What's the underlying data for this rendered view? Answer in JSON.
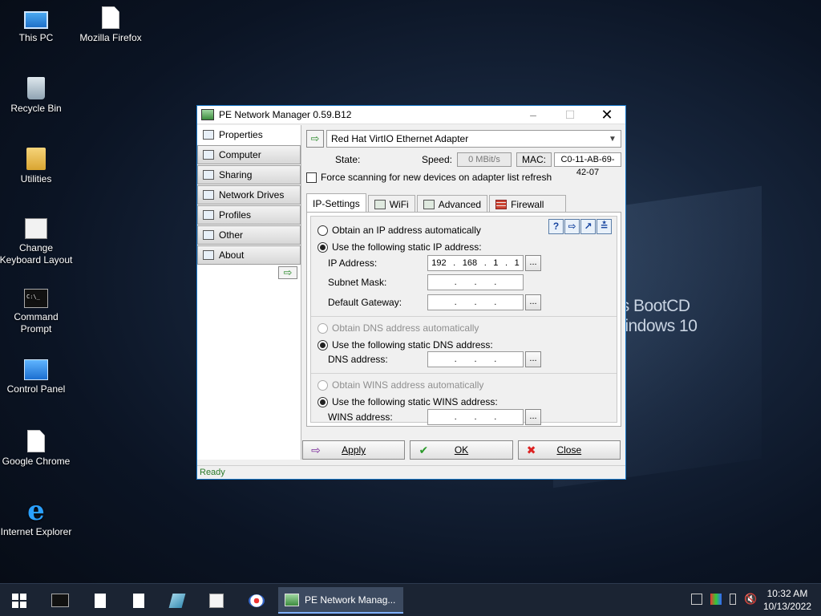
{
  "wallpaper": {
    "line1": "n's BootCD",
    "line2": "Windows 10"
  },
  "desktop_icons": [
    {
      "label": "This PC"
    },
    {
      "label": "Mozilla Firefox"
    },
    {
      "label": "Recycle Bin"
    },
    {
      "label": "Utilities"
    },
    {
      "label": "Change Keyboard Layout"
    },
    {
      "label": "Command Prompt"
    },
    {
      "label": "Control Panel"
    },
    {
      "label": "Google Chrome"
    },
    {
      "label": "Internet Explorer"
    }
  ],
  "window": {
    "title": "PE Network Manager 0.59.B12",
    "sidebar": [
      {
        "label": "Properties"
      },
      {
        "label": "Computer"
      },
      {
        "label": "Sharing"
      },
      {
        "label": "Network Drives"
      },
      {
        "label": "Profiles"
      },
      {
        "label": "Other"
      },
      {
        "label": "About"
      }
    ],
    "adapter": "Red Hat VirtIO Ethernet Adapter",
    "state_label": "State:",
    "speed_label": "Speed:",
    "speed_value": "0 MBit/s",
    "mac_label": "MAC:",
    "mac_value": "C0-11-AB-69-42-07",
    "force_scan_label": "Force scanning for new devices on adapter list refresh",
    "tabs": [
      {
        "label": "IP-Settings"
      },
      {
        "label": "WiFi"
      },
      {
        "label": "Advanced"
      },
      {
        "label": "Firewall"
      }
    ],
    "ip": {
      "auto_label": "Obtain an IP address automatically",
      "static_label": "Use the following static IP address:",
      "ip_label": "IP Address:",
      "ip_octets": [
        "192",
        "168",
        "1",
        "1"
      ],
      "mask_label": "Subnet Mask:",
      "gateway_label": "Default Gateway:",
      "dns_auto_label": "Obtain DNS address automatically",
      "dns_static_label": "Use the following static DNS address:",
      "dns_label": "DNS address:",
      "wins_auto_label": "Obtain WINS address automatically",
      "wins_static_label": "Use the following static WINS address:",
      "wins_label": "WINS address:",
      "dots": "...",
      "ip_sep": "."
    },
    "buttons": {
      "apply": "Apply",
      "ok": "OK",
      "close": "Close"
    },
    "status": "Ready"
  },
  "taskbar": {
    "active_label": "PE Network Manag...",
    "time": "10:32 AM",
    "date": "10/13/2022"
  },
  "colors": {
    "accent": "#1979ca",
    "status_green": "#2a7a2a",
    "taskbar": "#1b2433"
  }
}
